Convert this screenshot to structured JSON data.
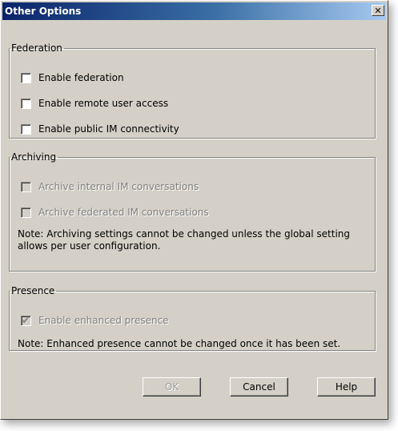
{
  "window": {
    "title": "Other Options",
    "close_glyph": "✕"
  },
  "federation": {
    "legend": "Federation",
    "options": [
      {
        "label": "Enable federation",
        "checked": false,
        "enabled": true
      },
      {
        "label": "Enable remote user access",
        "checked": false,
        "enabled": true
      },
      {
        "label": "Enable public IM connectivity",
        "checked": false,
        "enabled": true
      }
    ]
  },
  "archiving": {
    "legend": "Archiving",
    "options": [
      {
        "label": "Archive internal IM conversations",
        "checked": false,
        "enabled": false
      },
      {
        "label": "Archive federated IM conversations",
        "checked": false,
        "enabled": false
      }
    ],
    "note": "Note: Archiving settings cannot be changed unless the global setting allows per user configuration."
  },
  "presence": {
    "legend": "Presence",
    "options": [
      {
        "label": "Enable enhanced presence",
        "checked": true,
        "enabled": false
      }
    ],
    "note": "Note: Enhanced presence cannot be changed once it has been set."
  },
  "buttons": {
    "ok": "OK",
    "cancel": "Cancel",
    "help": "Help"
  }
}
